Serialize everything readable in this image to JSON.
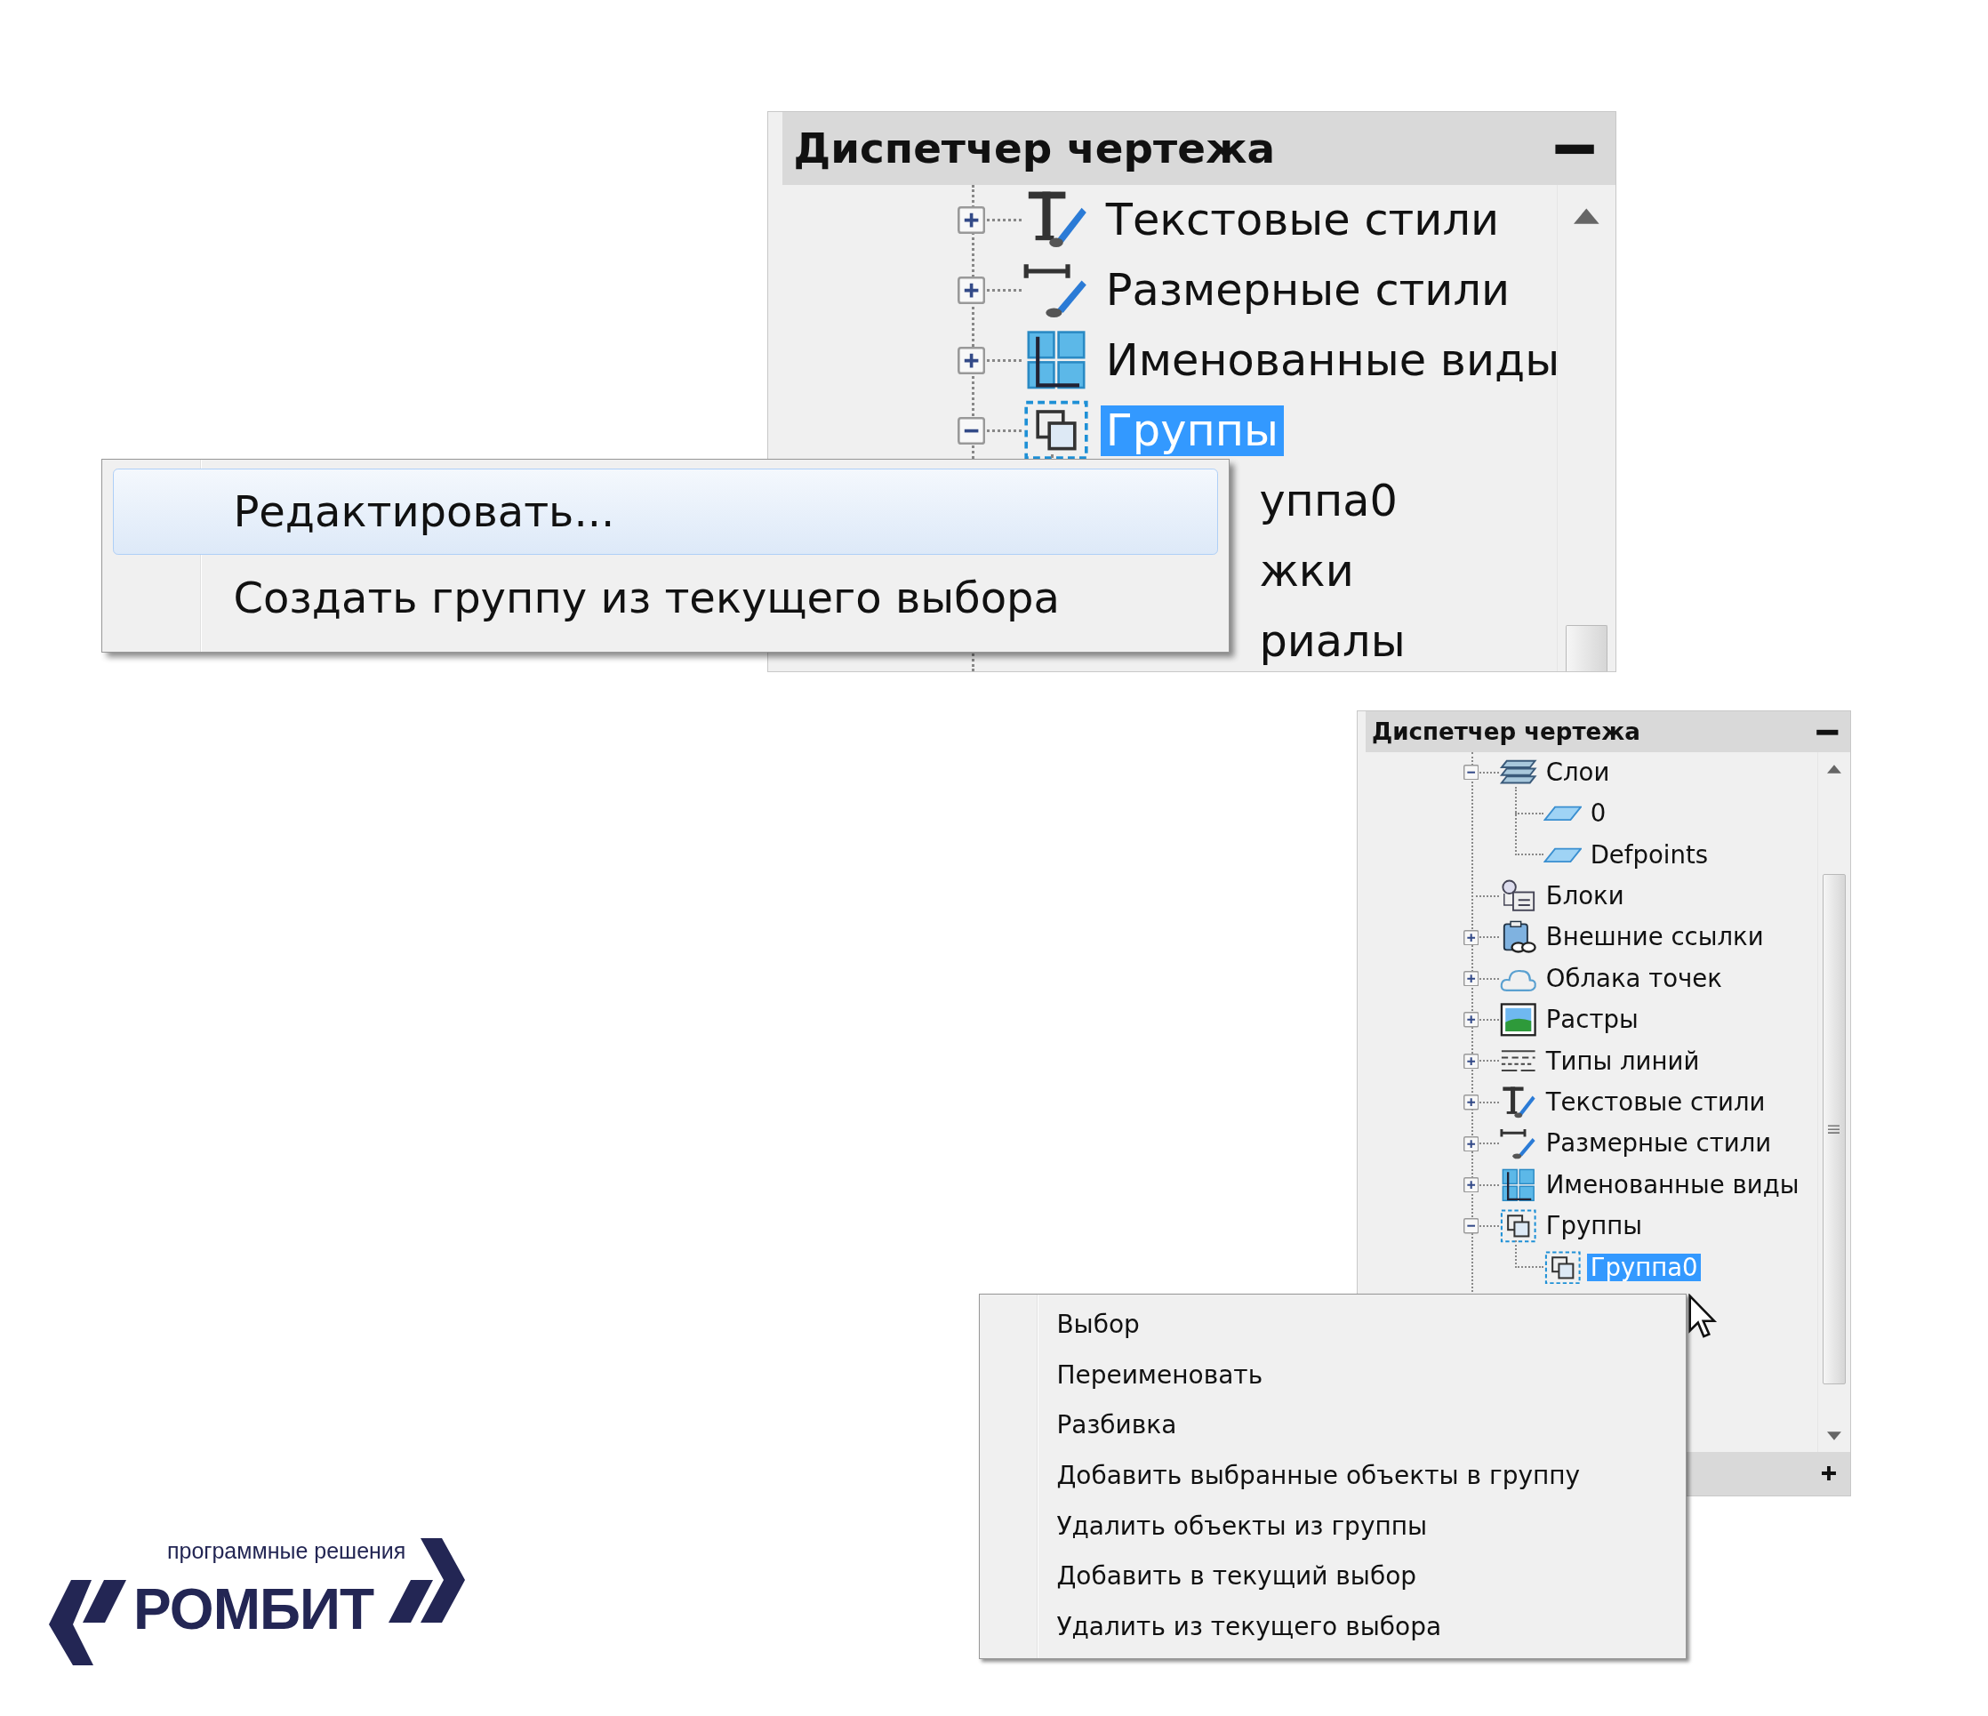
{
  "panels": [
    {
      "kind": "cropped",
      "title": "Диспетчер чертежа",
      "tree": [
        {
          "kind": "text-styles",
          "label": "Текстовые стили",
          "expanded": false,
          "selected": false
        },
        {
          "kind": "dim-styles",
          "label": "Размерные стили",
          "expanded": false,
          "selected": false
        },
        {
          "kind": "named-views",
          "label": "Именованные виды",
          "expanded": false,
          "selected": false
        },
        {
          "kind": "groups",
          "label": "Группы",
          "expanded": true,
          "selected": true,
          "children": [
            {
              "kind": "covered",
              "label": "уппа0",
              "selected": false
            }
          ]
        },
        {
          "kind": "covered",
          "label": "жки",
          "selected": false
        },
        {
          "kind": "covered",
          "label": "риалы",
          "selected": false
        }
      ]
    },
    {
      "kind": "full",
      "title": "Диспетчер чертежа",
      "tree": [
        {
          "kind": "layers",
          "label": "Слои",
          "expanded": true,
          "selected": false,
          "children": [
            {
              "kind": "layer",
              "label": "0",
              "selected": false
            },
            {
              "kind": "layer",
              "label": "Defpoints",
              "selected": false
            }
          ]
        },
        {
          "kind": "blocks",
          "label": "Блоки",
          "selected": false
        },
        {
          "kind": "xrefs",
          "label": "Внешние ссылки",
          "expanded": false,
          "selected": false
        },
        {
          "kind": "point-clouds",
          "label": "Облака точек",
          "expanded": false,
          "selected": false
        },
        {
          "kind": "rasters",
          "label": "Растры",
          "expanded": false,
          "selected": false
        },
        {
          "kind": "linetypes",
          "label": "Типы линий",
          "expanded": false,
          "selected": false
        },
        {
          "kind": "text-styles",
          "label": "Текстовые стили",
          "expanded": false,
          "selected": false
        },
        {
          "kind": "dim-styles",
          "label": "Размерные стили",
          "expanded": false,
          "selected": false
        },
        {
          "kind": "named-views",
          "label": "Именованные виды",
          "expanded": false,
          "selected": false
        },
        {
          "kind": "groups",
          "label": "Группы",
          "expanded": true,
          "selected": false,
          "children": [
            {
              "kind": "group",
              "label": "Группа0",
              "selected": true
            }
          ]
        }
      ]
    }
  ],
  "menus": [
    {
      "items": [
        {
          "label": "Редактировать...",
          "selected": true
        },
        {
          "label": "Создать группу из текущего выбора",
          "selected": false
        }
      ]
    },
    {
      "items": [
        {
          "label": "Выбор",
          "selected": false
        },
        {
          "label": "Переименовать",
          "selected": false
        },
        {
          "label": "Разбивка",
          "selected": false
        },
        {
          "label": "Добавить выбранные объекты в группу",
          "selected": false
        },
        {
          "label": "Удалить объекты из группы",
          "selected": false
        },
        {
          "label": "Добавить в текущий выбор",
          "selected": false
        },
        {
          "label": "Удалить из текущего выбора",
          "selected": false
        }
      ]
    }
  ],
  "logo": {
    "tagline": "программные решения",
    "name": "РОМБИТ"
  }
}
